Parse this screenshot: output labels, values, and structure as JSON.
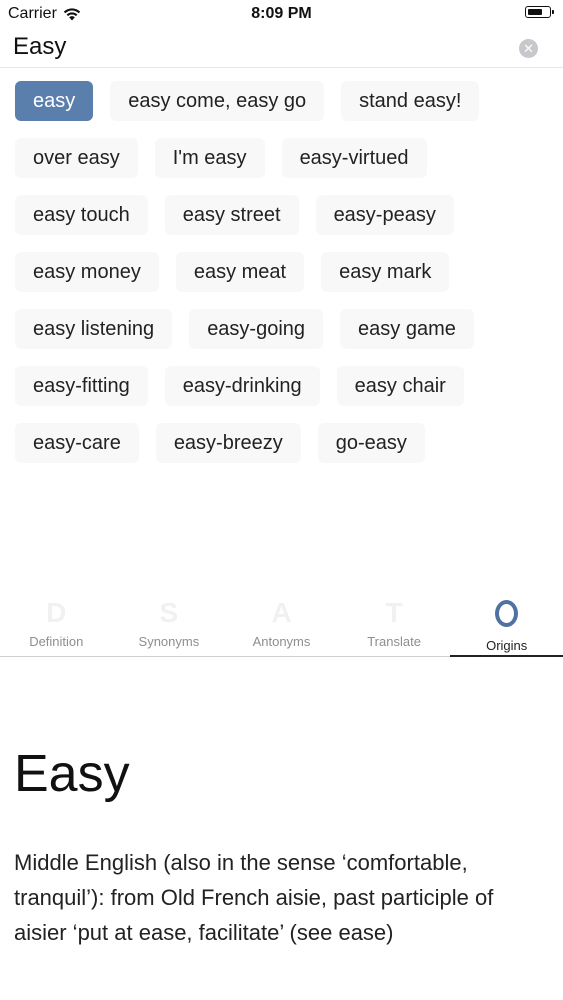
{
  "status_bar": {
    "carrier": "Carrier",
    "time": "8:09 PM"
  },
  "search": {
    "value": "Easy"
  },
  "chips": {
    "rows": [
      [
        "easy",
        "easy come, easy go",
        "stand easy!"
      ],
      [
        "over easy",
        "I'm easy",
        "easy-virtued"
      ],
      [
        "easy touch",
        "easy street",
        "easy-peasy"
      ],
      [
        "easy money",
        "easy meat",
        "easy mark"
      ],
      [
        "easy listening",
        "easy-going",
        "easy game"
      ],
      [
        "easy-fitting",
        "easy-drinking",
        "easy chair"
      ],
      [
        "easy-care",
        "easy-breezy",
        "go-easy"
      ]
    ],
    "selected": "easy"
  },
  "tabs": [
    {
      "letter": "D",
      "label": "Definition"
    },
    {
      "letter": "S",
      "label": "Synonyms"
    },
    {
      "letter": "A",
      "label": "Antonyms"
    },
    {
      "letter": "T",
      "label": "Translate"
    },
    {
      "letter": "O",
      "label": "Origins"
    }
  ],
  "active_tab": "Origins",
  "content": {
    "title": "Easy",
    "origin": "Middle English (also in the sense ‘comfortable, tranquil’): from Old French aisie, past participle of aisier ‘put at ease, facilitate’ (see ease)"
  },
  "colors": {
    "accent": "#5b7fad",
    "chip_bg": "#f8f8f8",
    "tab_icon": "#4f72a3"
  }
}
